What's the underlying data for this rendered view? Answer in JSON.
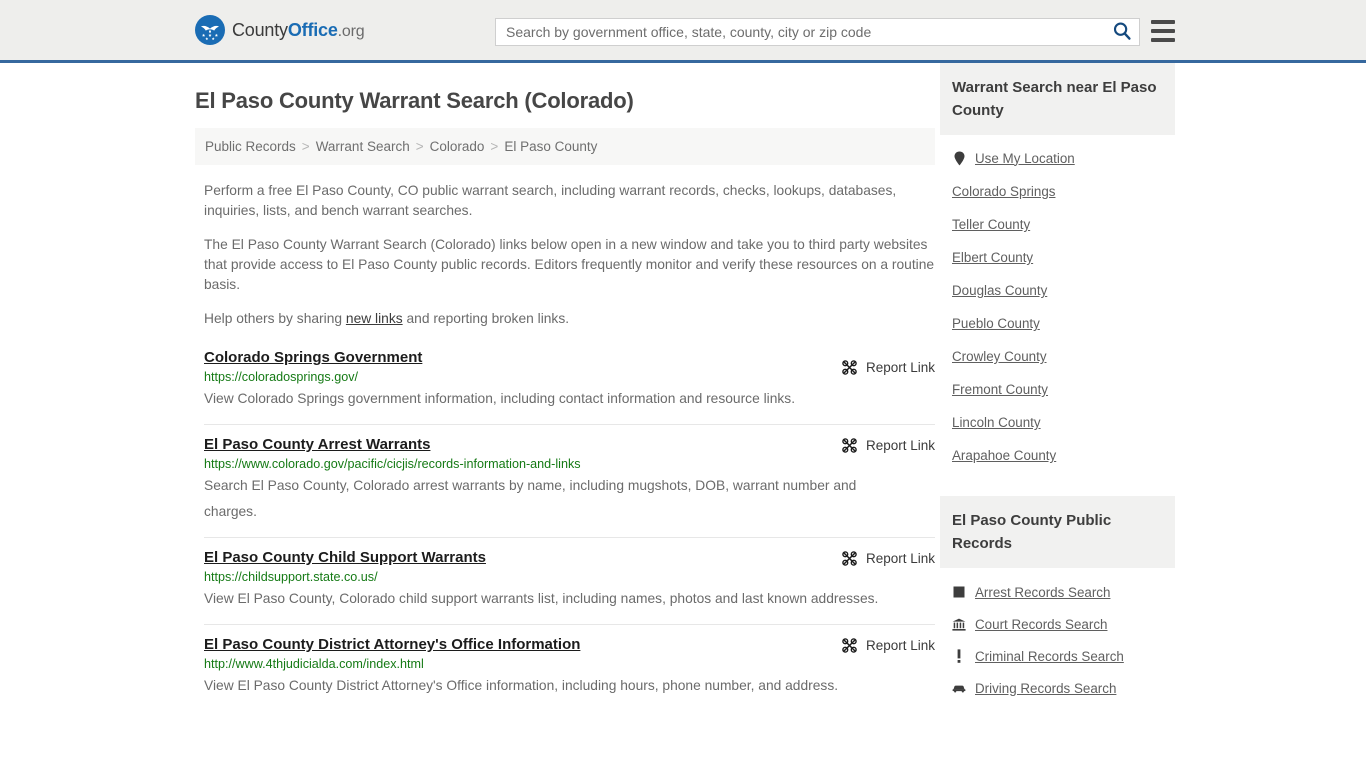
{
  "header": {
    "brand": {
      "part1": "County",
      "part2": "Office",
      "part3": ".org",
      "icon": "eagle-seal-icon"
    },
    "search": {
      "placeholder": "Search by government office, state, county, city or zip code",
      "value": "",
      "icon": "search-icon"
    },
    "menu_icon": "hamburger-menu-icon",
    "border_color": "#36689e"
  },
  "main": {
    "title": "El Paso County Warrant Search (Colorado)",
    "breadcrumb": [
      {
        "label": "Public Records"
      },
      {
        "label": "Warrant Search"
      },
      {
        "label": "Colorado"
      },
      {
        "label": "El Paso County"
      }
    ],
    "breadcrumb_separator": ">",
    "paragraphs": [
      {
        "text": "Perform a free El Paso County, CO public warrant search, including warrant records, checks, lookups, databases, inquiries, lists, and bench warrant searches."
      },
      {
        "text": "The El Paso County Warrant Search (Colorado) links below open in a new window and take you to third party websites that provide access to El Paso County public records. Editors frequently monitor and verify these resources on a routine basis."
      }
    ],
    "help_line": {
      "before": "Help others by sharing ",
      "link": "new links",
      "after": " and reporting broken links."
    },
    "report_link_label": "Report Link",
    "report_link_icon": "broken-link-icon",
    "results": [
      {
        "title": "Colorado Springs Government",
        "url": "https://coloradosprings.gov/",
        "description": "View Colorado Springs government information, including contact information and resource links."
      },
      {
        "title": "El Paso County Arrest Warrants",
        "url": "https://www.colorado.gov/pacific/cicjis/records-information-and-links",
        "description": "Search El Paso County, Colorado arrest warrants by name, including mugshots, DOB, warrant number and charges."
      },
      {
        "title": "El Paso County Child Support Warrants",
        "url": "https://childsupport.state.co.us/",
        "description": "View El Paso County, Colorado child support warrants list, including names, photos and last known addresses."
      },
      {
        "title": "El Paso County District Attorney's Office Information",
        "url": "http://www.4thjudicialda.com/index.html",
        "description": "View El Paso County District Attorney's Office information, including hours, phone number, and address."
      }
    ]
  },
  "sidebar": {
    "nearby": {
      "heading": "Warrant Search near El Paso County",
      "items": [
        {
          "label": "Use My Location",
          "icon": "map-pin-icon"
        },
        {
          "label": "Colorado Springs",
          "icon": ""
        },
        {
          "label": "Teller County",
          "icon": ""
        },
        {
          "label": "Elbert County",
          "icon": ""
        },
        {
          "label": "Douglas County",
          "icon": ""
        },
        {
          "label": "Pueblo County",
          "icon": ""
        },
        {
          "label": "Crowley County",
          "icon": ""
        },
        {
          "label": "Fremont County",
          "icon": ""
        },
        {
          "label": "Lincoln County",
          "icon": ""
        },
        {
          "label": "Arapahoe County",
          "icon": ""
        }
      ]
    },
    "public_records": {
      "heading": "El Paso County Public Records",
      "items": [
        {
          "label": "Arrest Records Search",
          "icon": "square-badge-icon"
        },
        {
          "label": "Court Records Search",
          "icon": "courthouse-icon"
        },
        {
          "label": "Criminal Records Search",
          "icon": "exclamation-icon"
        },
        {
          "label": "Driving Records Search",
          "icon": "car-icon"
        }
      ]
    }
  },
  "colors": {
    "brand_blue": "#1a6cb4",
    "header_bg": "#eeeeec",
    "url_green": "#157a15",
    "panel_gray": "#f1f1f0"
  }
}
